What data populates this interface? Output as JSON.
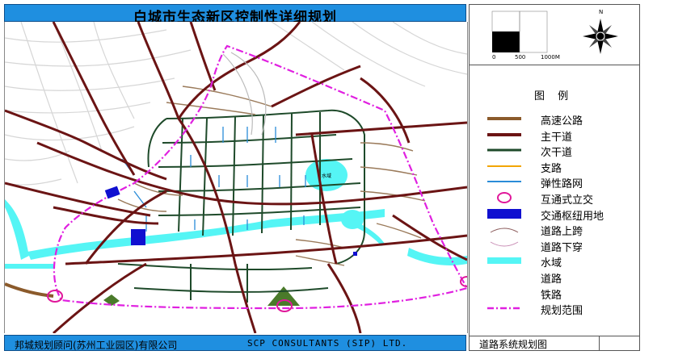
{
  "title": "白城市生态新区控制性详细规划",
  "footer": {
    "company_cn": "邦城规划顾问(苏州工业园区)有限公司",
    "company_en": "SCP CONSULTANTS (SIP) LTD."
  },
  "drawing_name": "道路系统规划图",
  "scale_bar": {
    "ticks": [
      "0",
      "500",
      "1000M"
    ]
  },
  "north_arrow": {
    "label": "N"
  },
  "legend": {
    "title": "图 例",
    "items": [
      {
        "label": "高速公路",
        "color": "#8B5A2B",
        "style": "thick-line"
      },
      {
        "label": "主干道",
        "color": "#6B1414",
        "style": "thick-line"
      },
      {
        "label": "次干道",
        "color": "#1E4A2A",
        "style": "line"
      },
      {
        "label": "支路",
        "color": "#F2A500",
        "style": "thin-line"
      },
      {
        "label": "弹性路网",
        "color": "#2A8CD8",
        "style": "thin-line"
      },
      {
        "label": "互通式立交",
        "color": "#E0179A",
        "style": "ellipse"
      },
      {
        "label": "交通枢纽用地",
        "color": "#1010D0",
        "style": "rect"
      },
      {
        "label": "道路上跨",
        "color": "#8B5A5A",
        "style": "arc-up"
      },
      {
        "label": "道路下穿",
        "color": "#C88CB4",
        "style": "arc-down"
      },
      {
        "label": "水域",
        "color": "#55F5F5",
        "style": "band"
      },
      {
        "label": "道路",
        "color": "#D8D8D8",
        "style": "none"
      },
      {
        "label": "铁路",
        "color": "#ffffff",
        "style": "none"
      },
      {
        "label": "规划范围",
        "color": "#E020E0",
        "style": "dashdot"
      }
    ]
  },
  "map": {
    "lake_label": "水域",
    "colors": {
      "expressway": "#8B5A2B",
      "arterial": "#6B1414",
      "secondary": "#1E4A2A",
      "local": "#F2A500",
      "flexible": "#2A8CD8",
      "boundary": "#E020E0",
      "water": "#55F5F5",
      "background_road": "#D6D6D6",
      "hub": "#1010D0",
      "green": "#4A7A2A"
    }
  }
}
